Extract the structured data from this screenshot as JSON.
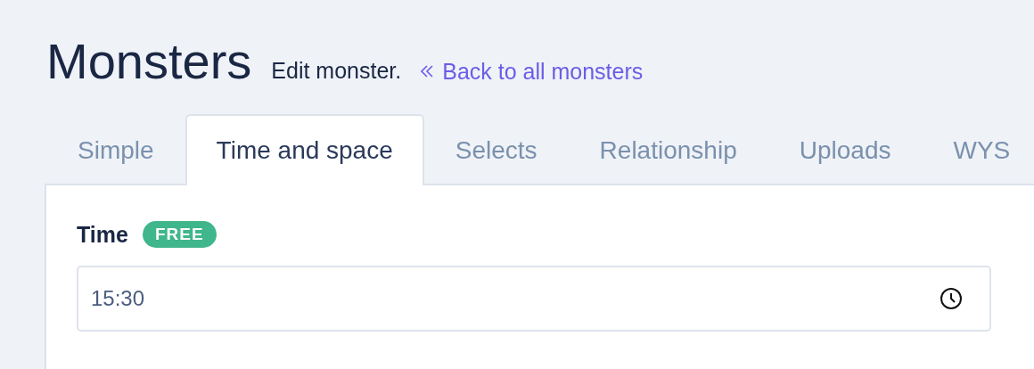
{
  "header": {
    "title": "Monsters",
    "subtitle": "Edit monster.",
    "back_link": "Back to all monsters"
  },
  "tabs": [
    {
      "label": "Simple",
      "selected": false
    },
    {
      "label": "Time and space",
      "selected": true
    },
    {
      "label": "Selects",
      "selected": false
    },
    {
      "label": "Relationship",
      "selected": false
    },
    {
      "label": "Uploads",
      "selected": false
    },
    {
      "label": "WYS",
      "selected": false
    }
  ],
  "field": {
    "label": "Time",
    "badge": "FREE",
    "value": "15:30"
  }
}
